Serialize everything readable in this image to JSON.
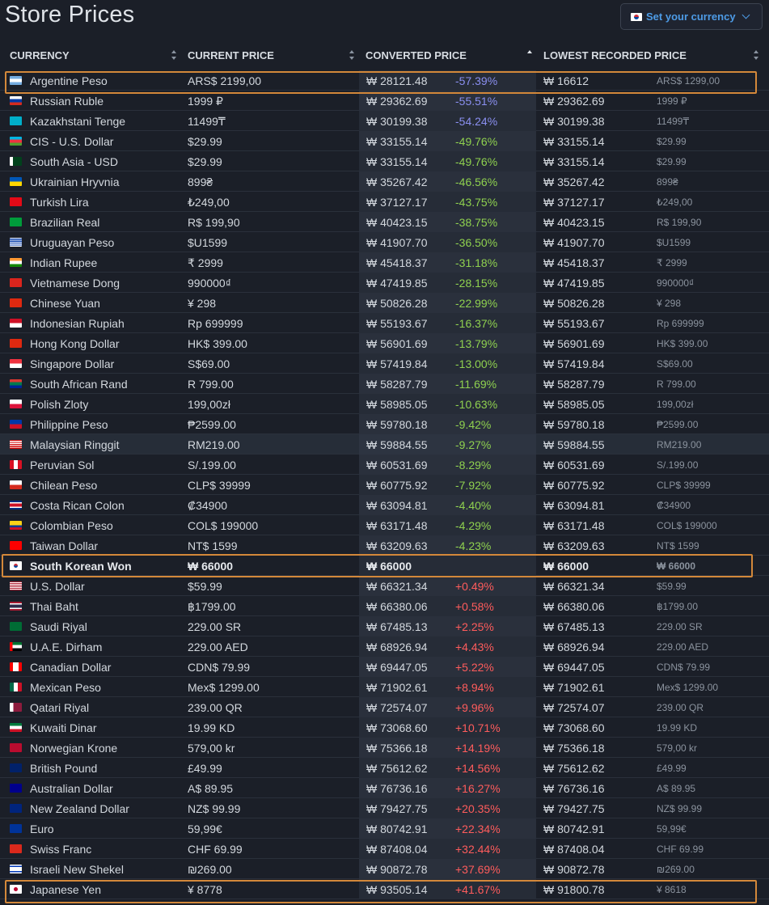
{
  "page": {
    "title": "Store Prices"
  },
  "currency_button": {
    "label": "Set your currency"
  },
  "colors": {
    "background": "#1b1f28",
    "accent": "#4d9be6",
    "negative_strong": "#8a8ff0",
    "negative": "#8fd14f",
    "positive": "#ff5c5c",
    "highlight": "#d3883a"
  },
  "table": {
    "headers": {
      "currency": "CURRENCY",
      "current_price": "CURRENT PRICE",
      "converted_price": "CONVERTED PRICE",
      "lowest_recorded_price": "LOWEST RECORDED PRICE"
    },
    "rows": [
      {
        "name": "Argentine Peso",
        "price": "ARS$ 2199,00",
        "conv": "₩ 28121.48",
        "diff": "-57.39%",
        "low": "₩ 16612",
        "lowloc": "ARS$ 1299,00",
        "flag": "ar"
      },
      {
        "name": "Russian Ruble",
        "price": "1999 ₽",
        "conv": "₩ 29362.69",
        "diff": "-55.51%",
        "low": "₩ 29362.69",
        "lowloc": "1999 ₽",
        "flag": "ru"
      },
      {
        "name": "Kazakhstani Tenge",
        "price": "11499₸",
        "conv": "₩ 30199.38",
        "diff": "-54.24%",
        "low": "₩ 30199.38",
        "lowloc": "11499₸",
        "flag": "kz"
      },
      {
        "name": "CIS - U.S. Dollar",
        "price": "$29.99",
        "conv": "₩ 33155.14",
        "diff": "-49.76%",
        "low": "₩ 33155.14",
        "lowloc": "$29.99",
        "flag": "az"
      },
      {
        "name": "South Asia - USD",
        "price": "$29.99",
        "conv": "₩ 33155.14",
        "diff": "-49.76%",
        "low": "₩ 33155.14",
        "lowloc": "$29.99",
        "flag": "pk"
      },
      {
        "name": "Ukrainian Hryvnia",
        "price": "899₴",
        "conv": "₩ 35267.42",
        "diff": "-46.56%",
        "low": "₩ 35267.42",
        "lowloc": "899₴",
        "flag": "ua"
      },
      {
        "name": "Turkish Lira",
        "price": "₺249,00",
        "conv": "₩ 37127.17",
        "diff": "-43.75%",
        "low": "₩ 37127.17",
        "lowloc": "₺249,00",
        "flag": "tr"
      },
      {
        "name": "Brazilian Real",
        "price": "R$ 199,90",
        "conv": "₩ 40423.15",
        "diff": "-38.75%",
        "low": "₩ 40423.15",
        "lowloc": "R$ 199,90",
        "flag": "br"
      },
      {
        "name": "Uruguayan Peso",
        "price": "$U1599",
        "conv": "₩ 41907.70",
        "diff": "-36.50%",
        "low": "₩ 41907.70",
        "lowloc": "$U1599",
        "flag": "uy"
      },
      {
        "name": "Indian Rupee",
        "price": "₹ 2999",
        "conv": "₩ 45418.37",
        "diff": "-31.18%",
        "low": "₩ 45418.37",
        "lowloc": "₹ 2999",
        "flag": "in"
      },
      {
        "name": "Vietnamese Dong",
        "price": "990000₫",
        "conv": "₩ 47419.85",
        "diff": "-28.15%",
        "low": "₩ 47419.85",
        "lowloc": "990000₫",
        "flag": "vn"
      },
      {
        "name": "Chinese Yuan",
        "price": "¥ 298",
        "conv": "₩ 50826.28",
        "diff": "-22.99%",
        "low": "₩ 50826.28",
        "lowloc": "¥ 298",
        "flag": "cn"
      },
      {
        "name": "Indonesian Rupiah",
        "price": "Rp 699999",
        "conv": "₩ 55193.67",
        "diff": "-16.37%",
        "low": "₩ 55193.67",
        "lowloc": "Rp 699999",
        "flag": "id"
      },
      {
        "name": "Hong Kong Dollar",
        "price": "HK$ 399.00",
        "conv": "₩ 56901.69",
        "diff": "-13.79%",
        "low": "₩ 56901.69",
        "lowloc": "HK$ 399.00",
        "flag": "hk"
      },
      {
        "name": "Singapore Dollar",
        "price": "S$69.00",
        "conv": "₩ 57419.84",
        "diff": "-13.00%",
        "low": "₩ 57419.84",
        "lowloc": "S$69.00",
        "flag": "sg"
      },
      {
        "name": "South African Rand",
        "price": "R 799.00",
        "conv": "₩ 58287.79",
        "diff": "-11.69%",
        "low": "₩ 58287.79",
        "lowloc": "R 799.00",
        "flag": "za"
      },
      {
        "name": "Polish Zloty",
        "price": "199,00zł",
        "conv": "₩ 58985.05",
        "diff": "-10.63%",
        "low": "₩ 58985.05",
        "lowloc": "199,00zł",
        "flag": "pl"
      },
      {
        "name": "Philippine Peso",
        "price": "₱2599.00",
        "conv": "₩ 59780.18",
        "diff": "-9.42%",
        "low": "₩ 59780.18",
        "lowloc": "₱2599.00",
        "flag": "ph"
      },
      {
        "name": "Malaysian Ringgit",
        "price": "RM219.00",
        "conv": "₩ 59884.55",
        "diff": "-9.27%",
        "low": "₩ 59884.55",
        "lowloc": "RM219.00",
        "flag": "my"
      },
      {
        "name": "Peruvian Sol",
        "price": "S/.199.00",
        "conv": "₩ 60531.69",
        "diff": "-8.29%",
        "low": "₩ 60531.69",
        "lowloc": "S/.199.00",
        "flag": "pe"
      },
      {
        "name": "Chilean Peso",
        "price": "CLP$ 39999",
        "conv": "₩ 60775.92",
        "diff": "-7.92%",
        "low": "₩ 60775.92",
        "lowloc": "CLP$ 39999",
        "flag": "cl"
      },
      {
        "name": "Costa Rican Colon",
        "price": "₡34900",
        "conv": "₩ 63094.81",
        "diff": "-4.40%",
        "low": "₩ 63094.81",
        "lowloc": "₡34900",
        "flag": "cr"
      },
      {
        "name": "Colombian Peso",
        "price": "COL$ 199000",
        "conv": "₩ 63171.48",
        "diff": "-4.29%",
        "low": "₩ 63171.48",
        "lowloc": "COL$ 199000",
        "flag": "co"
      },
      {
        "name": "Taiwan Dollar",
        "price": "NT$ 1599",
        "conv": "₩ 63209.63",
        "diff": "-4.23%",
        "low": "₩ 63209.63",
        "lowloc": "NT$ 1599",
        "flag": "tw"
      },
      {
        "name": "South Korean Won",
        "price": "₩ 66000",
        "conv": "₩ 66000",
        "diff": "",
        "low": "₩ 66000",
        "lowloc": "₩ 66000",
        "flag": "kr"
      },
      {
        "name": "U.S. Dollar",
        "price": "$59.99",
        "conv": "₩ 66321.34",
        "diff": "+0.49%",
        "low": "₩ 66321.34",
        "lowloc": "$59.99",
        "flag": "us"
      },
      {
        "name": "Thai Baht",
        "price": "฿1799.00",
        "conv": "₩ 66380.06",
        "diff": "+0.58%",
        "low": "₩ 66380.06",
        "lowloc": "฿1799.00",
        "flag": "th"
      },
      {
        "name": "Saudi Riyal",
        "price": "229.00 SR",
        "conv": "₩ 67485.13",
        "diff": "+2.25%",
        "low": "₩ 67485.13",
        "lowloc": "229.00 SR",
        "flag": "sa"
      },
      {
        "name": "U.A.E. Dirham",
        "price": "229.00 AED",
        "conv": "₩ 68926.94",
        "diff": "+4.43%",
        "low": "₩ 68926.94",
        "lowloc": "229.00 AED",
        "flag": "ae"
      },
      {
        "name": "Canadian Dollar",
        "price": "CDN$ 79.99",
        "conv": "₩ 69447.05",
        "diff": "+5.22%",
        "low": "₩ 69447.05",
        "lowloc": "CDN$ 79.99",
        "flag": "ca"
      },
      {
        "name": "Mexican Peso",
        "price": "Mex$ 1299.00",
        "conv": "₩ 71902.61",
        "diff": "+8.94%",
        "low": "₩ 71902.61",
        "lowloc": "Mex$ 1299.00",
        "flag": "mx"
      },
      {
        "name": "Qatari Riyal",
        "price": "239.00 QR",
        "conv": "₩ 72574.07",
        "diff": "+9.96%",
        "low": "₩ 72574.07",
        "lowloc": "239.00 QR",
        "flag": "qa"
      },
      {
        "name": "Kuwaiti Dinar",
        "price": "19.99 KD",
        "conv": "₩ 73068.60",
        "diff": "+10.71%",
        "low": "₩ 73068.60",
        "lowloc": "19.99 KD",
        "flag": "kw"
      },
      {
        "name": "Norwegian Krone",
        "price": "579,00 kr",
        "conv": "₩ 75366.18",
        "diff": "+14.19%",
        "low": "₩ 75366.18",
        "lowloc": "579,00 kr",
        "flag": "no"
      },
      {
        "name": "British Pound",
        "price": "£49.99",
        "conv": "₩ 75612.62",
        "diff": "+14.56%",
        "low": "₩ 75612.62",
        "lowloc": "£49.99",
        "flag": "gb"
      },
      {
        "name": "Australian Dollar",
        "price": "A$ 89.95",
        "conv": "₩ 76736.16",
        "diff": "+16.27%",
        "low": "₩ 76736.16",
        "lowloc": "A$ 89.95",
        "flag": "au"
      },
      {
        "name": "New Zealand Dollar",
        "price": "NZ$ 99.99",
        "conv": "₩ 79427.75",
        "diff": "+20.35%",
        "low": "₩ 79427.75",
        "lowloc": "NZ$ 99.99",
        "flag": "nz"
      },
      {
        "name": "Euro",
        "price": "59,99€",
        "conv": "₩ 80742.91",
        "diff": "+22.34%",
        "low": "₩ 80742.91",
        "lowloc": "59,99€",
        "flag": "eu"
      },
      {
        "name": "Swiss Franc",
        "price": "CHF 69.99",
        "conv": "₩ 87408.04",
        "diff": "+32.44%",
        "low": "₩ 87408.04",
        "lowloc": "CHF 69.99",
        "flag": "ch"
      },
      {
        "name": "Israeli New Shekel",
        "price": "₪269.00",
        "conv": "₩ 90872.78",
        "diff": "+37.69%",
        "low": "₩ 90872.78",
        "lowloc": "₪269.00",
        "flag": "il"
      },
      {
        "name": "Japanese Yen",
        "price": "¥ 8778",
        "conv": "₩ 93505.14",
        "diff": "+41.67%",
        "low": "₩ 91800.78",
        "lowloc": "¥ 8618",
        "flag": "jp"
      }
    ]
  }
}
